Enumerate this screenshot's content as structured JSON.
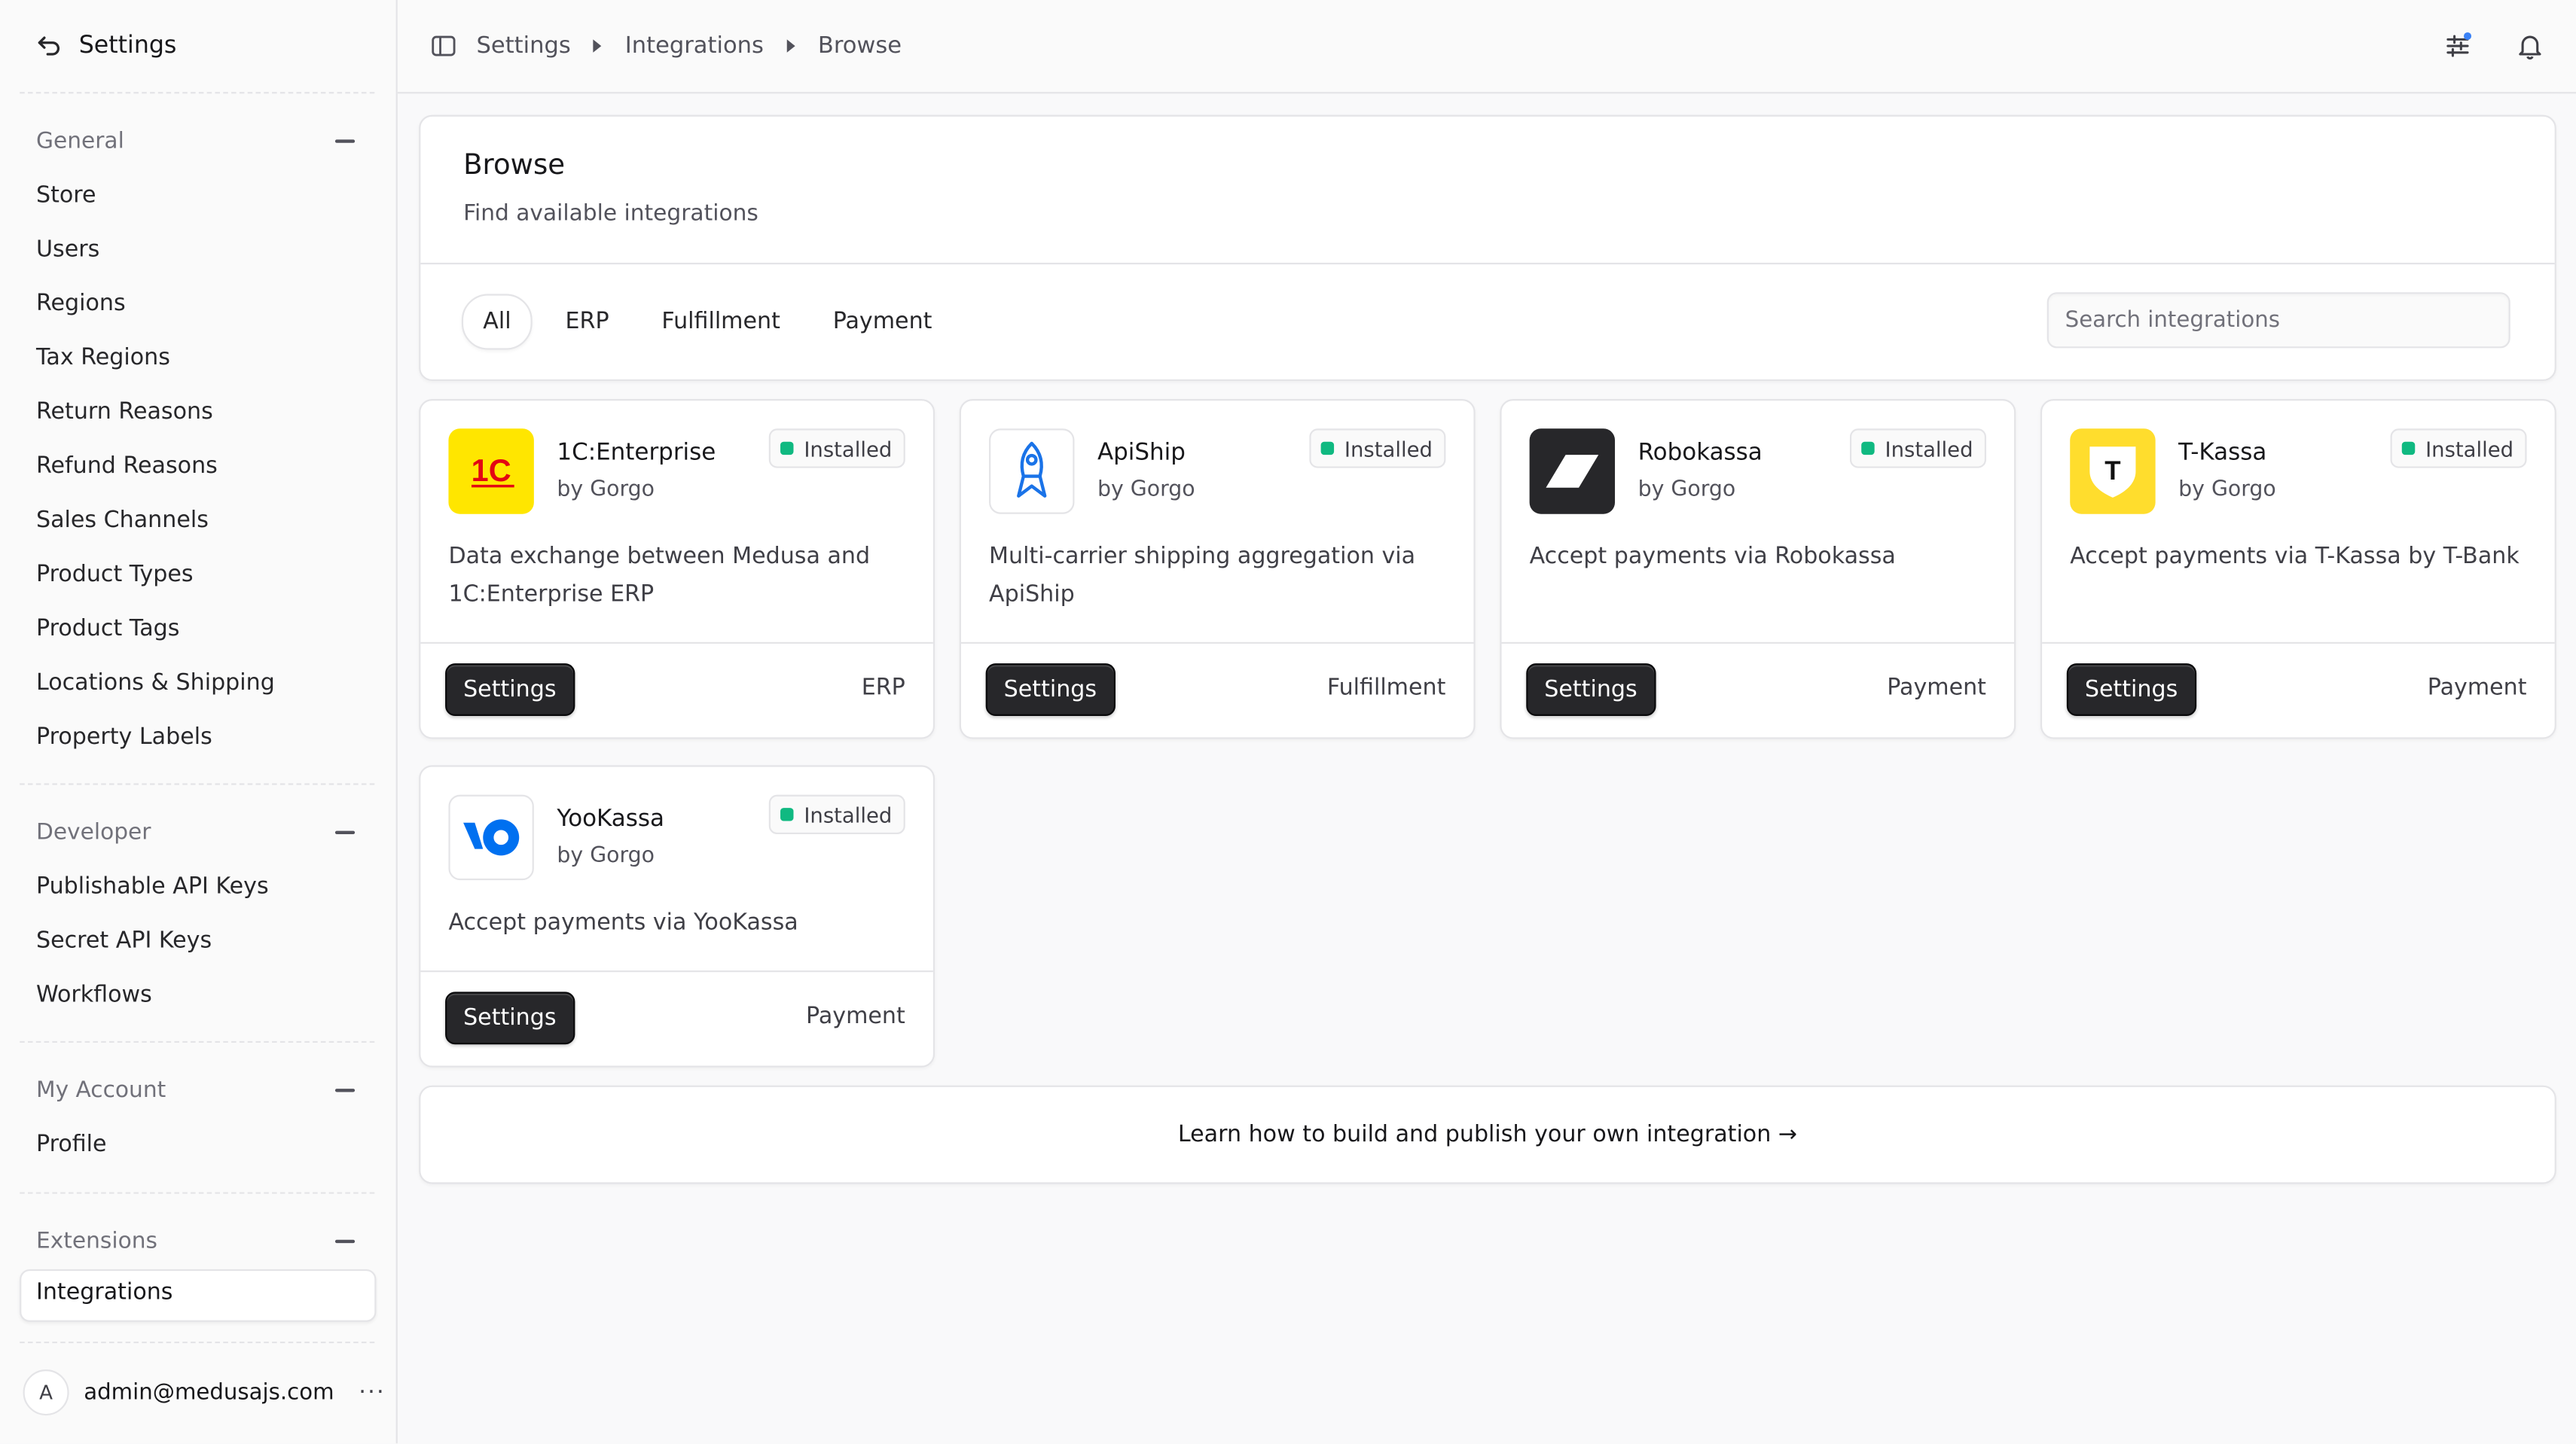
{
  "sidebar": {
    "back_label": "Settings",
    "groups": [
      {
        "title": "General",
        "items": [
          "Store",
          "Users",
          "Regions",
          "Tax Regions",
          "Return Reasons",
          "Refund Reasons",
          "Sales Channels",
          "Product Types",
          "Product Tags",
          "Locations & Shipping",
          "Property Labels"
        ]
      },
      {
        "title": "Developer",
        "items": [
          "Publishable API Keys",
          "Secret API Keys",
          "Workflows"
        ]
      },
      {
        "title": "My Account",
        "items": [
          "Profile"
        ]
      },
      {
        "title": "Extensions",
        "items": [
          "Integrations"
        ]
      }
    ],
    "active_item": "Integrations",
    "user": {
      "initial": "A",
      "email": "admin@medusajs.com",
      "more": "···"
    }
  },
  "breadcrumb": [
    "Settings",
    "Integrations",
    "Browse"
  ],
  "page": {
    "title": "Browse",
    "subtitle": "Find available integrations",
    "tabs": [
      "All",
      "ERP",
      "Fulfillment",
      "Payment"
    ],
    "active_tab": "All",
    "search_placeholder": "Search integrations"
  },
  "integrations": [
    {
      "name": "1C:Enterprise",
      "by": "by Gorgo",
      "status": "Installed",
      "description": "Data exchange between Medusa and 1C:Enterprise ERP",
      "button": "Settings",
      "category": "ERP",
      "logo_icon": "1c-logo-icon",
      "logo_text": "1C",
      "logo_color": "#ffe600"
    },
    {
      "name": "ApiShip",
      "by": "by Gorgo",
      "status": "Installed",
      "description": "Multi-carrier shipping aggregation via ApiShip",
      "button": "Settings",
      "category": "Fulfillment",
      "logo_icon": "apiship-rocket-icon",
      "logo_color": "#1a73e8"
    },
    {
      "name": "Robokassa",
      "by": "by Gorgo",
      "status": "Installed",
      "description": "Accept payments via Robokassa",
      "button": "Settings",
      "category": "Payment",
      "logo_icon": "robokassa-logo-icon",
      "logo_color": "#27272a"
    },
    {
      "name": "T-Kassa",
      "by": "by Gorgo",
      "status": "Installed",
      "description": "Accept payments via T-Kassa by T-Bank",
      "button": "Settings",
      "category": "Payment",
      "logo_icon": "tkassa-shield-icon",
      "logo_text": "T",
      "logo_color": "#ffdd2d"
    },
    {
      "name": "YooKassa",
      "by": "by Gorgo",
      "status": "Installed",
      "description": "Accept payments via YooKassa",
      "button": "Settings",
      "category": "Payment",
      "logo_icon": "yookassa-logo-icon",
      "logo_color": "#0070f0"
    }
  ],
  "learn_link": "Learn how to build and publish your own integration →",
  "status_color": "#10b981"
}
